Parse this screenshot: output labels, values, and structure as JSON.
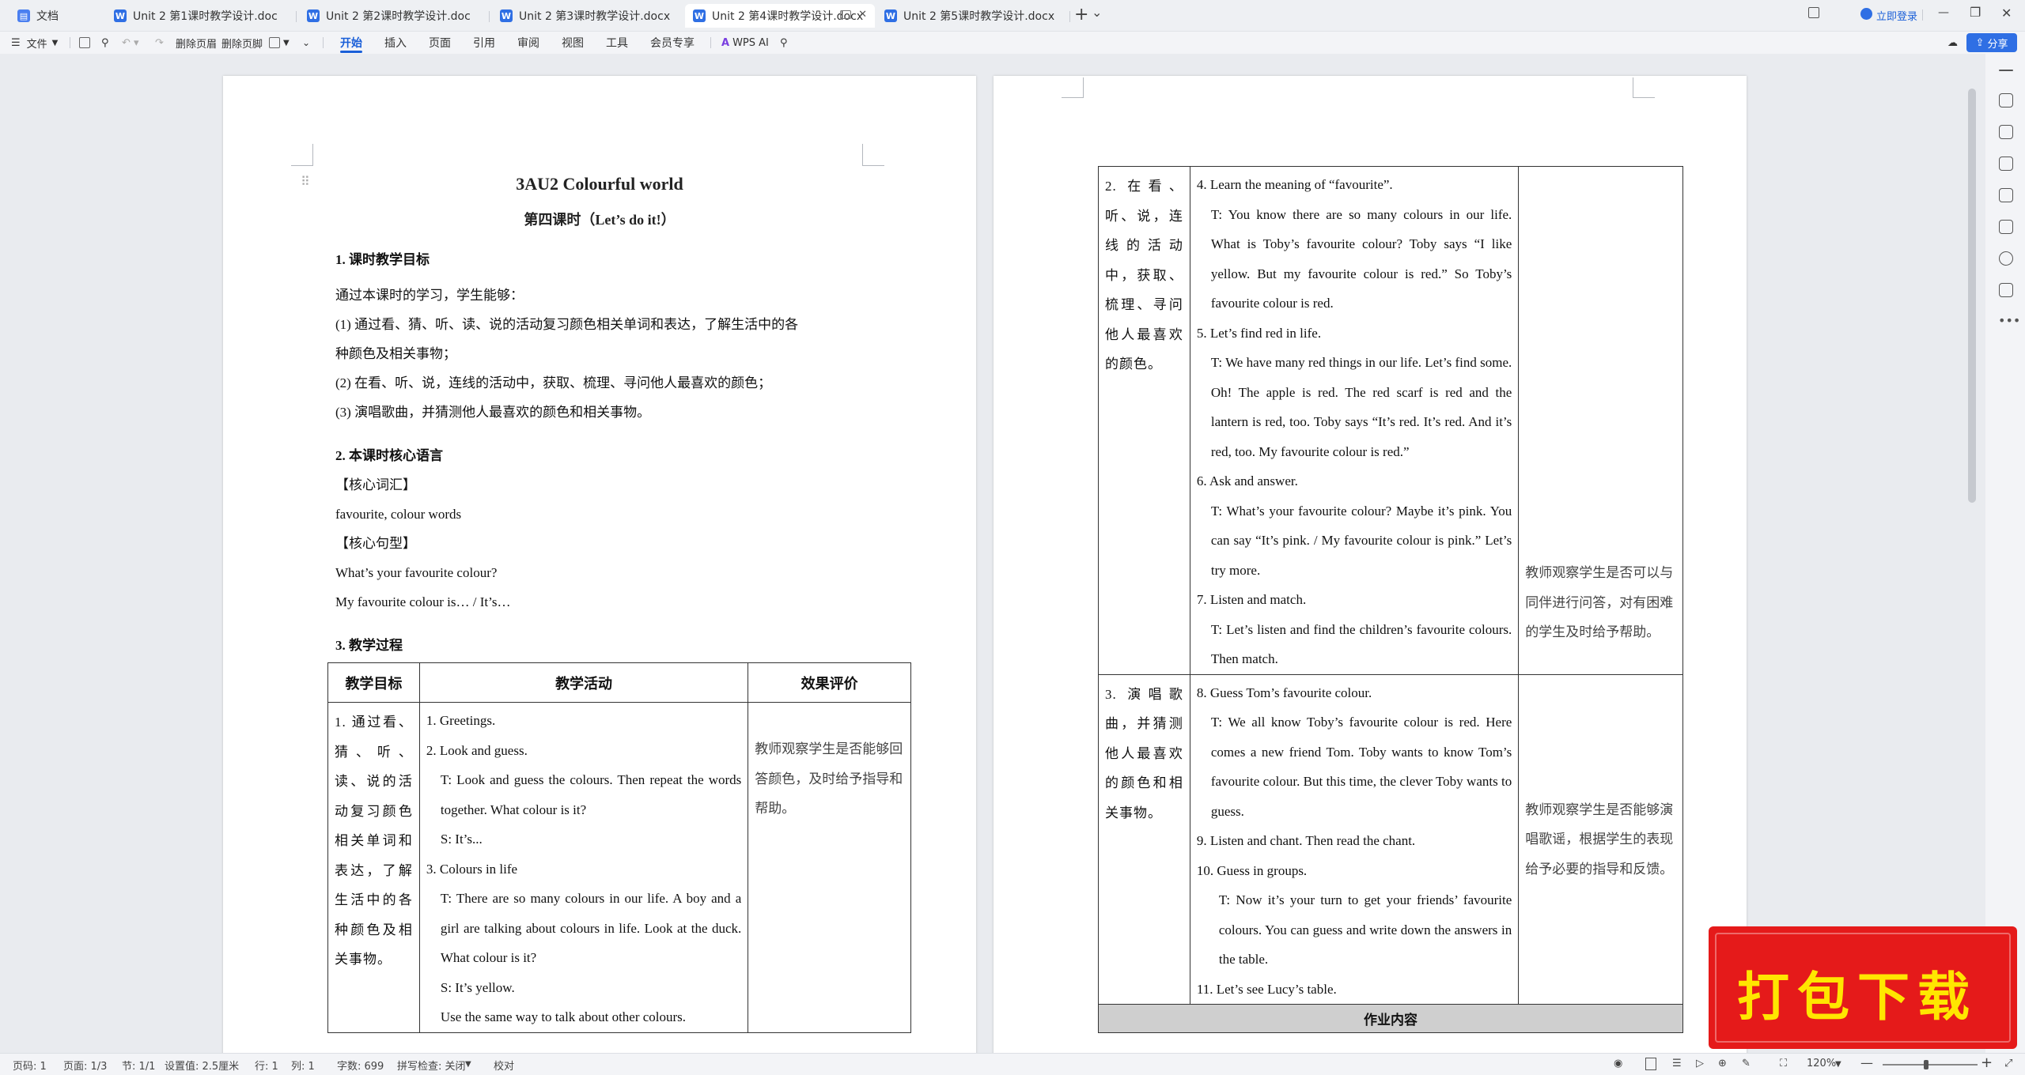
{
  "tabs": [
    {
      "label": "文档",
      "icon": "home-doc-icon"
    },
    {
      "label": "Unit 2 第1课时教学设计.doc",
      "icon": "word-doc-icon"
    },
    {
      "label": "Unit 2 第2课时教学设计.doc",
      "icon": "word-doc-icon"
    },
    {
      "label": "Unit 2 第3课时教学设计.docx",
      "icon": "word-doc-icon"
    },
    {
      "label": "Unit 2 第4课时教学设计.docx",
      "icon": "word-doc-icon"
    },
    {
      "label": "Unit 2 第5课时教学设计.docx",
      "icon": "word-doc-icon"
    }
  ],
  "tabs_ext": {
    "new_tab": "+",
    "more": "⌄"
  },
  "login": {
    "label": "立即登录"
  },
  "window": {
    "min": "—",
    "restore": "❐",
    "close": "✕"
  },
  "toolbar": {
    "file": "文件",
    "delete_header": "删除页眉",
    "delete_footer": "删除页脚",
    "menus": [
      "开始",
      "插入",
      "页面",
      "引用",
      "审阅",
      "视图",
      "工具",
      "会员专享"
    ],
    "wps_ai": "WPS AI",
    "share": "分享"
  },
  "doc": {
    "title": "3AU2 Colourful world",
    "subtitle": "第四课时（Let’s do it!）",
    "s1_heading": "1.  课时教学目标",
    "s1_intro": "通过本课时的学习，学生能够：",
    "s1_item1a": "(1)  通过看、猜、听、读、说的活动复习颜色相关单词和表达，了解生活中的各",
    "s1_item1b": "种颜色及相关事物；",
    "s1_item2": "(2)  在看、听、说，连线的活动中，获取、梳理、寻问他人最喜欢的颜色；",
    "s1_item3": "(3)  演唱歌曲，并猜测他人最喜欢的颜色和相关事物。",
    "s2_heading": "2.  本课时核心语言",
    "s2_vocab_label": "【核心词汇】",
    "s2_vocab": "favourite, colour words",
    "s2_sent_label": "【核心句型】",
    "s2_sent1": "What’s your favourite colour?",
    "s2_sent2": "My favourite colour is… / It’s…",
    "s3_heading": "3.  教学过程",
    "table_headers": [
      "教学目标",
      "教学活动",
      "效果评价"
    ],
    "row1": {
      "goal": "1. 通过看、猜、听、读、说的活动复习颜色相关单词和表达，了解生活中的各种颜色及相关事物。",
      "activities": [
        {
          "t": "1. Greetings.",
          "ind": 0
        },
        {
          "t": "2. Look and guess.",
          "ind": 0
        },
        {
          "t": "T: Look and guess the colours. Then repeat the words together. What colour is it?",
          "ind": 1
        },
        {
          "t": "S: It’s...",
          "ind": 1
        },
        {
          "t": "3. Colours in life",
          "ind": 0
        },
        {
          "t": "T: There are so many colours in our life. A boy and a girl are talking about colours in life. Look at the duck. What colour is it?",
          "ind": 1
        },
        {
          "t": "S: It’s yellow.",
          "ind": 1
        },
        {
          "t": "Use the same way to talk about other colours.",
          "ind": 1
        }
      ],
      "eval": "教师观察学生是否能够回答颜色，及时给予指导和帮助。"
    },
    "row2": {
      "goal": "2. 在看、听、说，连线的活动中，获取、梳理、寻问他人最喜欢的颜色。",
      "activities": [
        {
          "t": "4. Learn the meaning of “favourite”.",
          "ind": 0
        },
        {
          "t": "T: You know there are so many colours in our life. What is Toby’s favourite colour? Toby says “I like yellow. But my favourite colour is red.” So Toby’s favourite colour is red.",
          "ind": 1
        },
        {
          "t": "5. Let’s find red in life.",
          "ind": 0
        },
        {
          "t": "T: We have many red things in our life. Let’s find some. Oh! The apple is red. The red scarf is red and the lantern is red, too. Toby says “It’s red. It’s red. And it’s red, too. My favourite colour is red.”",
          "ind": 1
        },
        {
          "t": "6. Ask and answer.",
          "ind": 0
        },
        {
          "t": "T: What’s your favourite colour? Maybe it’s pink. You can say “It’s pink. / My favourite colour is pink.” Let’s try more.",
          "ind": 1
        },
        {
          "t": "7. Listen and match.",
          "ind": 0
        },
        {
          "t": "T: Let’s listen and find the children’s favourite colours. Then match.",
          "ind": 1
        }
      ],
      "eval": "教师观察学生是否可以与同伴进行问答，对有困难的学生及时给予帮助。"
    },
    "row3": {
      "goal": "3. 演唱歌曲，并猜测他人最喜欢的颜色和相关事物。",
      "activities": [
        {
          "t": "8. Guess Tom’s favourite colour.",
          "ind": 0
        },
        {
          "t": "T: We all know Toby’s favourite colour is red. Here comes a new friend Tom. Toby wants to know Tom’s favourite colour. But this time, the clever Toby wants to guess.",
          "ind": 1
        },
        {
          "t": "9. Listen and chant. Then read the chant.",
          "ind": 0
        },
        {
          "t": "10. Guess in groups.",
          "ind": 0
        },
        {
          "t": "T: Now it’s your turn to get your friends’ favourite colours. You can guess and write down the answers in the table.",
          "ind": 2
        },
        {
          "t": "11. Let’s see Lucy’s table.",
          "ind": 0
        }
      ],
      "eval": "教师观察学生是否能够演唱歌谣，根据学生的表现给予必要的指导和反馈。"
    },
    "homework_header": "作业内容"
  },
  "status": {
    "page": "页码: 1",
    "pages": "页面: 1/3",
    "section": "节: 1/1",
    "setting": "设置值: 2.5厘米",
    "row": "行: 1",
    "col": "列: 1",
    "words": "字数: 699",
    "spell": "拼写检查: 关闭",
    "proof": "校对",
    "zoom": "120%"
  },
  "promo": {
    "text": "打包下载"
  },
  "colors": {
    "accent": "#1a5fd8",
    "share_bg": "#2f6fe4",
    "promo_bg": "#e51a1a",
    "promo_text": "#ffe600"
  }
}
